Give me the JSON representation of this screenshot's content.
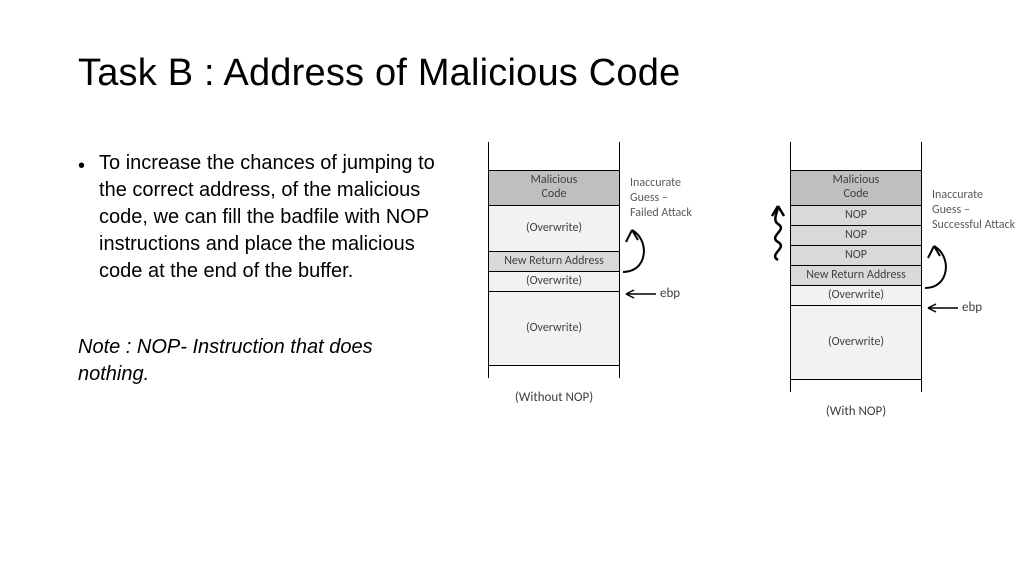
{
  "title": "Task B : Address of Malicious Code",
  "bullet": "To increase the chances of jumping to the correct address, of the malicious code, we can fill the badfile with NOP instructions and place the malicious code at the end of the buffer.",
  "note": "Note : NOP- Instruction that does nothing.",
  "left": {
    "cells": {
      "malicious": "Malicious\nCode",
      "overwrite1": "(Overwrite)",
      "new_return": "New Return Address",
      "overwrite2": "(Overwrite)",
      "overwrite3": "(Overwrite)"
    },
    "side_note": "Inaccurate\nGuess –\nFailed Attack",
    "ebp": "ebp",
    "caption": "(Without NOP)"
  },
  "right": {
    "cells": {
      "malicious": "Malicious\nCode",
      "nop1": "NOP",
      "nop2": "NOP",
      "nop3": "NOP",
      "new_return": "New Return Address",
      "overwrite1": "(Overwrite)",
      "overwrite2": "(Overwrite)"
    },
    "side_note": "Inaccurate\nGuess –\nSuccessful Attack",
    "ebp": "ebp",
    "caption": "(With NOP)"
  }
}
